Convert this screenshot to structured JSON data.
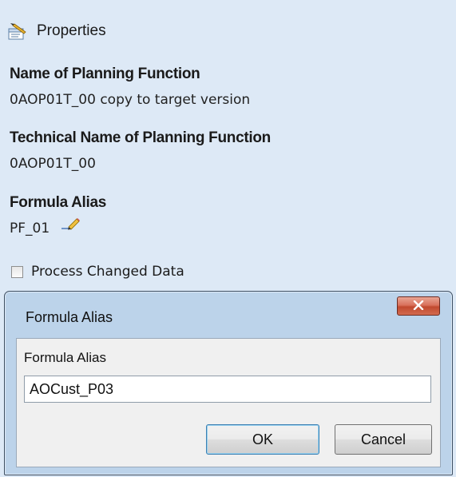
{
  "properties": {
    "title": "Properties",
    "icon": "properties-icon"
  },
  "fields": {
    "name_label": "Name of Planning Function",
    "name_value": "0AOP01T_00 copy to target version",
    "technical_label": "Technical Name of Planning Function",
    "technical_value": "0AOP01T_00",
    "alias_label": "Formula Alias",
    "alias_value": "PF_01"
  },
  "checkbox": {
    "label": "Process Changed Data",
    "checked": false
  },
  "dialog": {
    "title": "Formula Alias",
    "close_label": "x",
    "input_label": "Formula Alias",
    "input_value": "AOCust_P03",
    "ok_label": "OK",
    "cancel_label": "Cancel"
  }
}
